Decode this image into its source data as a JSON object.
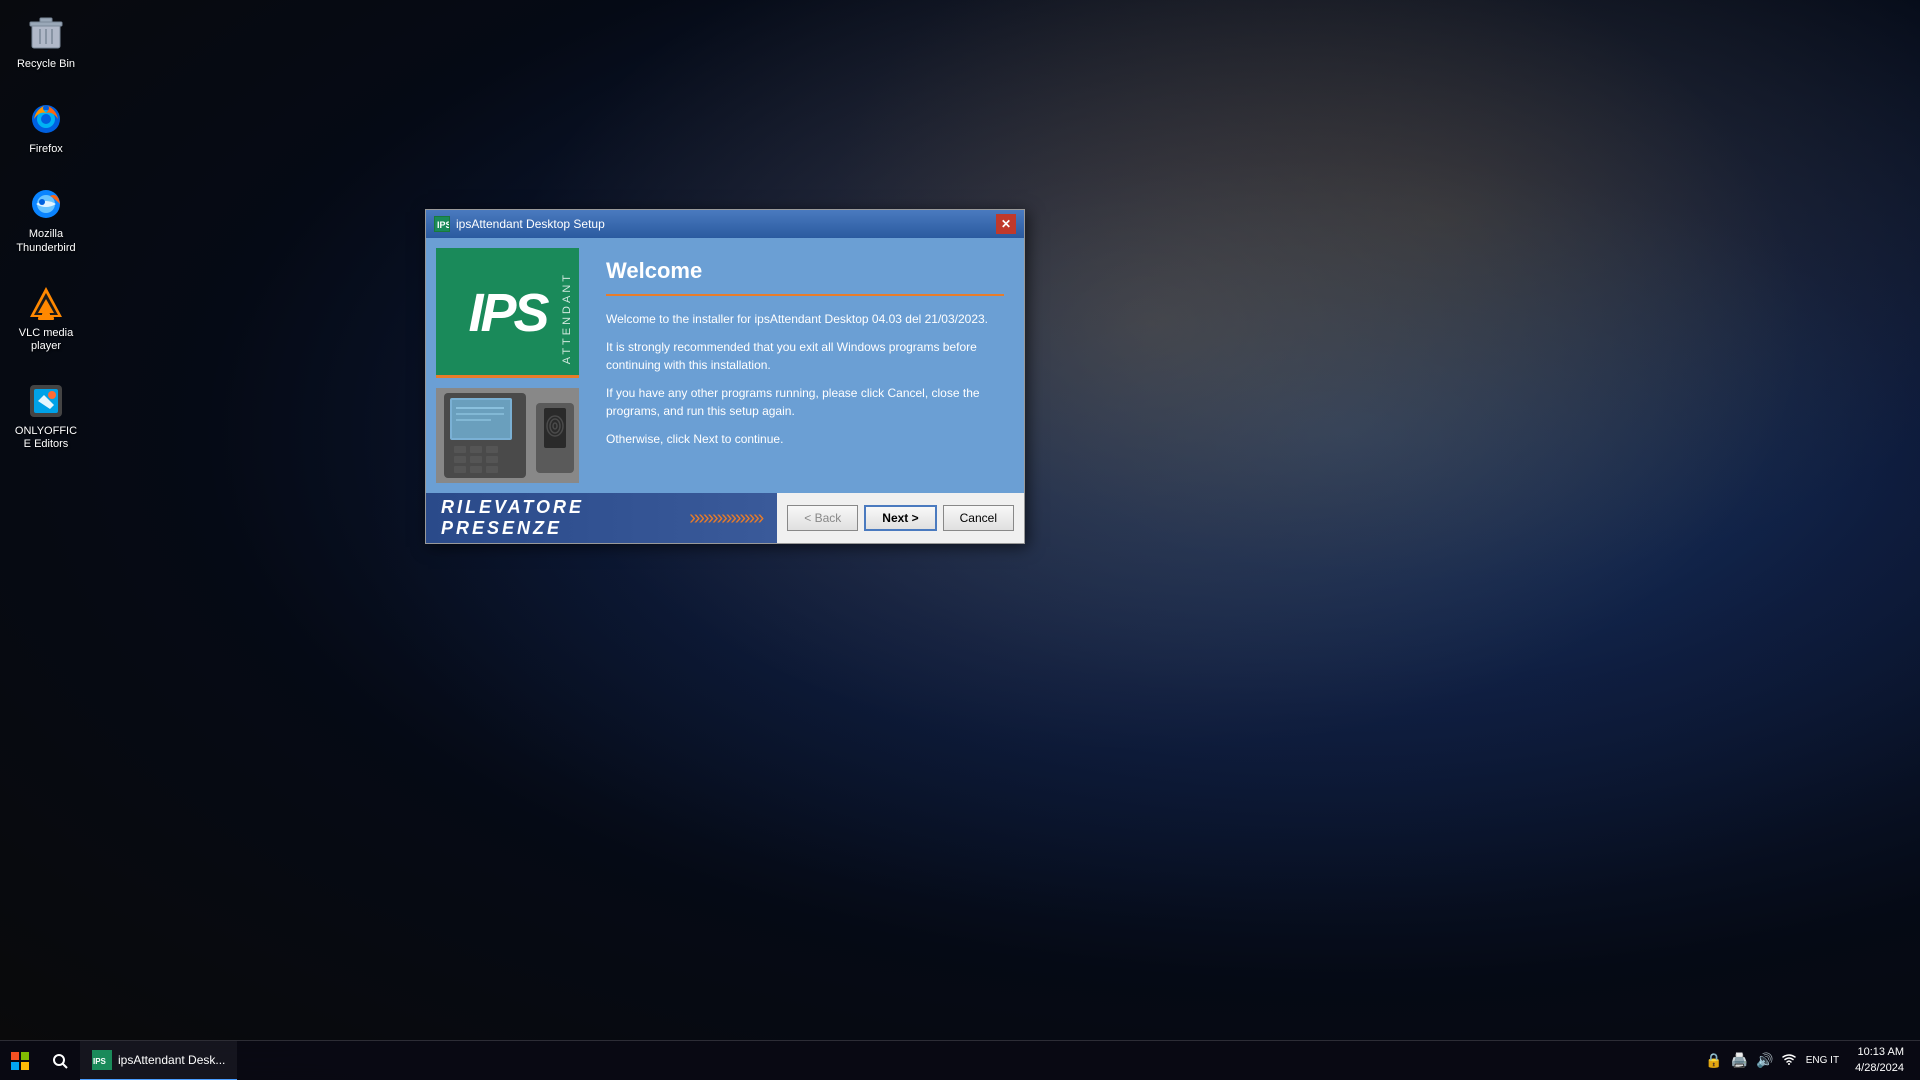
{
  "desktop": {
    "icons": [
      {
        "id": "recycle-bin",
        "label": "Recycle Bin",
        "icon": "🗑️"
      },
      {
        "id": "firefox",
        "label": "Firefox",
        "icon": "🦊"
      },
      {
        "id": "thunderbird",
        "label": "Mozilla Thunderbird",
        "icon": "🐦"
      },
      {
        "id": "vlc",
        "label": "VLC media player",
        "icon": "🔶"
      },
      {
        "id": "onlyoffice",
        "label": "ONLYOFFICE Editors",
        "icon": "📄"
      }
    ]
  },
  "taskbar": {
    "start_icon": "⊞",
    "search_icon": "🔍",
    "app_label": "ipsAttendant Desk...",
    "tray_icons": [
      "🔒",
      "🖨️",
      "🔊"
    ],
    "language": "ENG\nIT",
    "time": "10:13 AM",
    "date": "4/28/2024"
  },
  "dialog": {
    "title": "ipsAttendant Desktop Setup",
    "close_icon": "✕",
    "ips_logo_text": "IPS",
    "ips_attendant_text": "ATTENDANT",
    "welcome_heading": "Welcome",
    "separator_color": "#e87c2a",
    "welcome_line1": "Welcome to the installer for ipsAttendant Desktop 04.03 del 21/03/2023.",
    "welcome_line2": "It is strongly recommended that you exit all Windows programs before continuing with this installation.",
    "welcome_line3": "If you have any other programs running, please click Cancel, close the programs, and run this setup again.",
    "welcome_line4": "Otherwise, click Next to continue.",
    "footer_text": "RILEVATORE PRESENZE",
    "footer_arrows": "»»»»»»»»",
    "btn_back": "< Back",
    "btn_next": "Next >",
    "btn_cancel": "Cancel"
  }
}
